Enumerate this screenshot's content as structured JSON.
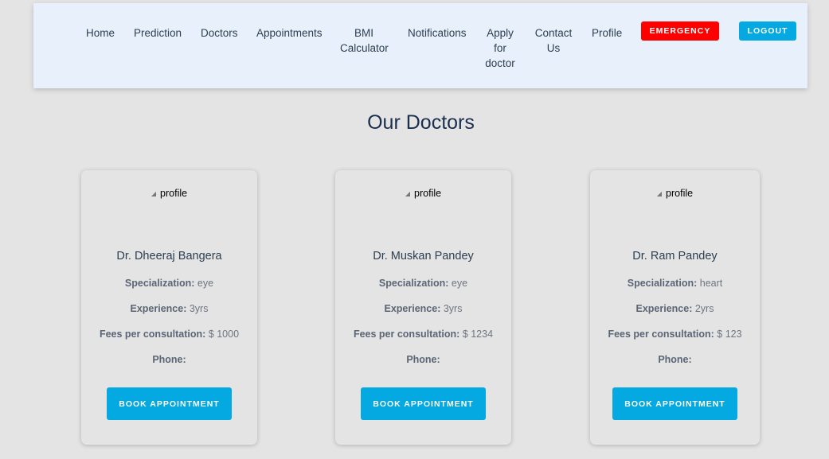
{
  "nav": {
    "home": "Home",
    "prediction": "Prediction",
    "doctors": "Doctors",
    "appointments": "Appointments",
    "bmi_line1": "BMI",
    "bmi_line2": "Calculator",
    "notifications": "Notifications",
    "apply_line1": "Apply",
    "apply_line2": "for",
    "apply_line3": "doctor",
    "contact_line1": "Contact",
    "contact_line2": "Us",
    "profile": "Profile",
    "emergency": "EMERGENCY",
    "logout": "LOGOUT"
  },
  "page_title": "Our Doctors",
  "labels": {
    "specialization": "Specialization:",
    "experience": "Experience:",
    "fees": "Fees per consultation:",
    "phone": "Phone:",
    "image_alt": "profile",
    "book": "BOOK APPOINTMENT"
  },
  "doctors": [
    {
      "name": "Dr. Dheeraj Bangera",
      "specialization": "eye",
      "experience": "3yrs",
      "fees": "$ 1000",
      "phone": ""
    },
    {
      "name": "Dr. Muskan Pandey",
      "specialization": "eye",
      "experience": "3yrs",
      "fees": "$ 1234",
      "phone": ""
    },
    {
      "name": "Dr. Ram Pandey",
      "specialization": "heart",
      "experience": "2yrs",
      "fees": "$ 123",
      "phone": ""
    }
  ],
  "colors": {
    "emergency": "#fe0000",
    "accent": "#03a9e0",
    "navbar_bg": "#e8f1fb",
    "page_bg": "#e4e4e4"
  }
}
